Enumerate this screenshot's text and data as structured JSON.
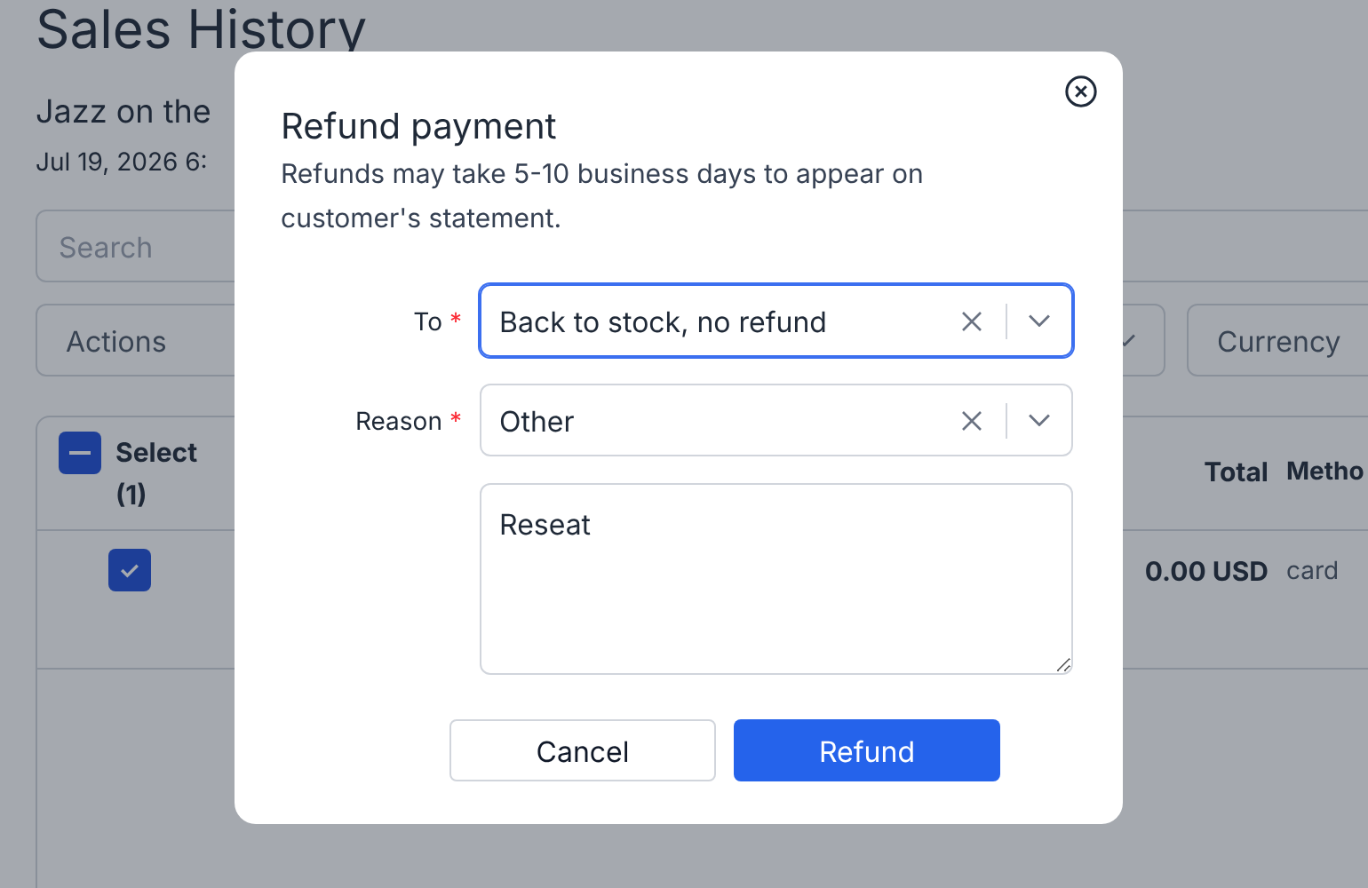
{
  "page": {
    "title": "Sales History",
    "subtitle": "Jazz on the",
    "date": "Jul 19, 2026 6:",
    "search": {
      "placeholder": "Search"
    },
    "filters": [
      {
        "label": "Actions",
        "kind": "plain"
      },
      {
        "kind": "chevron-only"
      },
      {
        "label": "Currency",
        "kind": "plain"
      }
    ],
    "table": {
      "select_all": {
        "label": "Select (1)",
        "partial": true
      },
      "columns": [
        "Total",
        "Metho"
      ],
      "rows": [
        {
          "checked": true,
          "cells": [
            "0.00 USD",
            "card"
          ]
        }
      ]
    }
  },
  "dialog": {
    "title": "Refund payment",
    "description": "Refunds may take 5-10 business days to appear on customer's statement.",
    "fields": [
      {
        "kind": "select",
        "label": "To",
        "required_mark": "*",
        "value": "Back to stock, no refund",
        "focused": true
      },
      {
        "kind": "select",
        "label": "Reason",
        "required_mark": "*",
        "value": "Other",
        "focused": false
      },
      {
        "kind": "textarea",
        "value": "Reseat"
      }
    ],
    "buttons": [
      {
        "label": "Cancel",
        "kind": "secondary"
      },
      {
        "label": "Refund",
        "kind": "primary"
      }
    ]
  }
}
